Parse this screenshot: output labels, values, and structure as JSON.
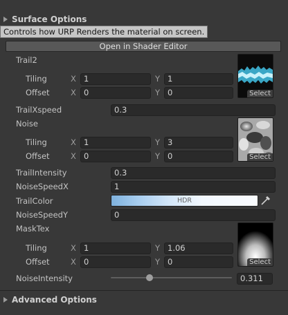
{
  "surface_options": {
    "label": "Surface Options"
  },
  "tooltip": {
    "text": "Controls how URP Renders the material on screen."
  },
  "shader_editor_button": {
    "label": "Open in Shader Editor"
  },
  "trail2": {
    "label": "Trail2",
    "tiling_label": "Tiling",
    "offset_label": "Offset",
    "tiling_x": "1",
    "tiling_y": "1",
    "offset_x": "0",
    "offset_y": "0",
    "select_label": "Select"
  },
  "trail_x_speed": {
    "label": "TrailXspeed",
    "value": "0.3"
  },
  "noise": {
    "label": "Noise",
    "tiling_label": "Tiling",
    "offset_label": "Offset",
    "tiling_x": "1",
    "tiling_y": "3",
    "offset_x": "0",
    "offset_y": "0",
    "select_label": "Select"
  },
  "trail_intensity": {
    "label": "TrailIntensity",
    "value": "0.3"
  },
  "noise_speed_x": {
    "label": "NoiseSpeedX",
    "value": "1"
  },
  "trail_color": {
    "label": "TrailColor",
    "hdr_label": "HDR"
  },
  "noise_speed_y": {
    "label": "NoiseSpeedY",
    "value": "0"
  },
  "mask_tex": {
    "label": "MaskTex",
    "tiling_label": "Tiling",
    "offset_label": "Offset",
    "tiling_x": "1",
    "tiling_y": "1.06",
    "offset_x": "0",
    "offset_y": "0",
    "select_label": "Select"
  },
  "noise_intensity": {
    "label": "NoiseIntensity",
    "value": "0.311",
    "slider_fraction": 0.311
  },
  "advanced_options": {
    "label": "Advanced Options"
  },
  "axis": {
    "x": "X",
    "y": "Y"
  },
  "colors": {
    "panel_bg": "#383838",
    "field_bg": "#2a2a2a",
    "trail_cyan": "#6fd6f0",
    "hdr_blue": "#7fb2de"
  }
}
